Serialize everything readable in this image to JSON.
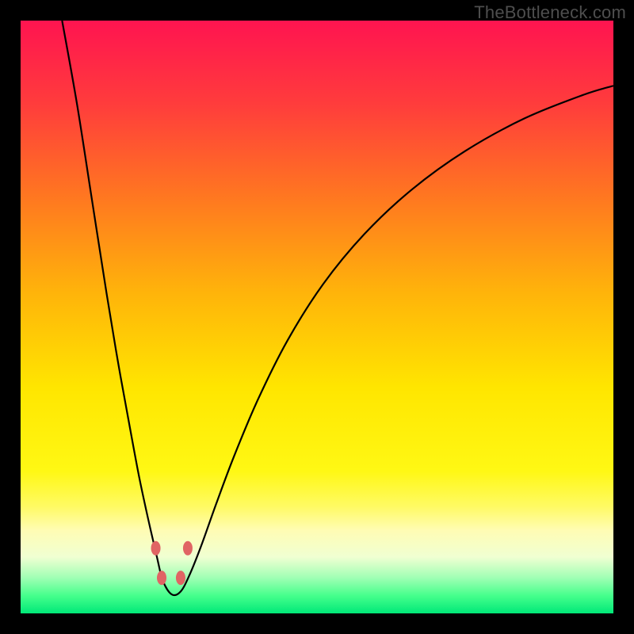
{
  "watermark": "TheBottleneck.com",
  "chart_data": {
    "type": "line",
    "title": "",
    "xlabel": "",
    "ylabel": "",
    "xlim": [
      0,
      100
    ],
    "ylim": [
      0,
      100
    ],
    "background_gradient": {
      "stops": [
        {
          "offset": 0.0,
          "color": "#ff1450"
        },
        {
          "offset": 0.14,
          "color": "#ff3c3c"
        },
        {
          "offset": 0.3,
          "color": "#ff7820"
        },
        {
          "offset": 0.46,
          "color": "#ffb40a"
        },
        {
          "offset": 0.62,
          "color": "#ffe600"
        },
        {
          "offset": 0.76,
          "color": "#fff814"
        },
        {
          "offset": 0.82,
          "color": "#fffa64"
        },
        {
          "offset": 0.86,
          "color": "#fffcb4"
        },
        {
          "offset": 0.905,
          "color": "#f0ffd2"
        },
        {
          "offset": 0.94,
          "color": "#a0ffb4"
        },
        {
          "offset": 0.97,
          "color": "#46ff8c"
        },
        {
          "offset": 1.0,
          "color": "#00e878"
        }
      ]
    },
    "curve": {
      "description": "V-shaped bottleneck curve: x-position relative to plot width, y = percent of plot height from top",
      "minimum_x": 25.5,
      "points": [
        {
          "x": 7.0,
          "y": 0.0
        },
        {
          "x": 9.5,
          "y": 14.0
        },
        {
          "x": 12.0,
          "y": 30.0
        },
        {
          "x": 14.5,
          "y": 46.0
        },
        {
          "x": 16.5,
          "y": 58.0
        },
        {
          "x": 18.5,
          "y": 69.0
        },
        {
          "x": 20.0,
          "y": 77.0
        },
        {
          "x": 21.5,
          "y": 84.0
        },
        {
          "x": 23.0,
          "y": 90.5
        },
        {
          "x": 24.0,
          "y": 94.5
        },
        {
          "x": 25.5,
          "y": 96.8
        },
        {
          "x": 27.0,
          "y": 96.3
        },
        {
          "x": 28.5,
          "y": 93.5
        },
        {
          "x": 30.5,
          "y": 88.5
        },
        {
          "x": 33.0,
          "y": 81.5
        },
        {
          "x": 36.0,
          "y": 73.5
        },
        {
          "x": 40.0,
          "y": 64.0
        },
        {
          "x": 45.0,
          "y": 54.0
        },
        {
          "x": 51.0,
          "y": 44.5
        },
        {
          "x": 58.0,
          "y": 36.0
        },
        {
          "x": 66.0,
          "y": 28.5
        },
        {
          "x": 75.0,
          "y": 22.0
        },
        {
          "x": 85.0,
          "y": 16.5
        },
        {
          "x": 95.0,
          "y": 12.5
        },
        {
          "x": 100.0,
          "y": 11.0
        }
      ]
    },
    "markers": [
      {
        "x": 22.8,
        "y": 89.0
      },
      {
        "x": 23.8,
        "y": 94.0
      },
      {
        "x": 27.0,
        "y": 94.0
      },
      {
        "x": 28.2,
        "y": 89.0
      }
    ],
    "marker_style": {
      "fill": "#e06464",
      "rx": 6,
      "ry": 9
    }
  }
}
